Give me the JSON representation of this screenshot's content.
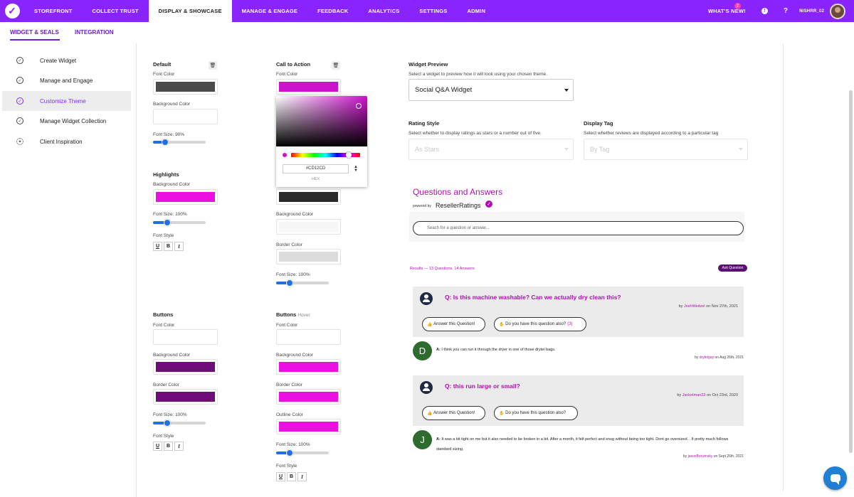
{
  "nav": {
    "items": [
      "STOREFRONT",
      "COLLECT TRUST",
      "DISPLAY & SHOWCASE",
      "MANAGE & ENGAGE",
      "FEEDBACK",
      "ANALYTICS",
      "SETTINGS",
      "ADMIN"
    ],
    "whats_new": "WHAT'S NEW!",
    "whats_new_badge": "2",
    "info_icon": "!",
    "help": "?",
    "username": "NISHRR_02"
  },
  "subtabs": [
    "WIDGET & SEALS",
    "INTEGRATION"
  ],
  "sidebar": {
    "items": [
      "Create Widget",
      "Manage and Engage",
      "Customize Theme",
      "Manage Widget Collection",
      "Client Inspiration"
    ]
  },
  "colors": {
    "brand": "#8a24ff",
    "default_font": "#4b4b4b",
    "cta_font": "#cd12cd",
    "highlight_bg": "#e910e0",
    "buttons_bg": "#6f0d78",
    "buttons_border": "#6f0d78",
    "hover_bg": "#e910e0",
    "hover_border": "#e910e0",
    "hover_outline": "#e910e0",
    "cta_dark": "#2a2a2a",
    "cta_bg": "#f7f7f7",
    "cta_border": "#dcdcdc"
  },
  "theme": {
    "default": {
      "title": "Default",
      "font_color": "Font Color",
      "bg_color": "Background Color",
      "font_size": "Font Size: 90%"
    },
    "highlights": {
      "title": "Highlights",
      "bg_color": "Background Color",
      "font_size": "Font Size: 100%",
      "font_style": "Font Style"
    },
    "buttons": {
      "title": "Buttons",
      "font_color": "Font Color",
      "bg_color": "Background Color",
      "border_color": "Border Color",
      "font_size": "Font Size: 100%",
      "font_style": "Font Style"
    },
    "cta": {
      "title": "Call to Action",
      "font_color": "Font Color",
      "bg_color": "Background Color",
      "border_color": "Border Color",
      "font_size": "Font Size: 100%"
    },
    "buttons_hover": {
      "title": "Buttons",
      "sub": "Hover",
      "font_color": "Font Color",
      "bg_color": "Background Color",
      "border_color": "Border Color",
      "outline_color": "Outline Color",
      "font_size": "Font Size: 100%",
      "font_style": "Font Style"
    },
    "style_buttons": [
      "U",
      "B",
      "I"
    ],
    "sliders": {
      "default": 0.25,
      "highlights": 0.3,
      "buttons": 0.3,
      "cta": 0.25,
      "hover": 0.25
    }
  },
  "picker": {
    "hex": "#CD12CD",
    "hex_label": "HEX"
  },
  "preview": {
    "title": "Widget Preview",
    "desc": "Select a widget to preview how it will look using your chosen theme.",
    "widget": "Social Q&A Widget",
    "rating_title": "Rating Style",
    "rating_desc": "Select whether to display ratings as stars or a number out of five.",
    "rating_value": "As Stars",
    "tag_title": "Display Tag",
    "tag_desc": "Select whether reviews are displayed according to a particular tag",
    "tag_value": "By Tag"
  },
  "qa": {
    "title": "Questions and Answers",
    "powered_by": "powered by",
    "brand": "ResellerRatings",
    "search_placeholder": "Seach for a question or answer...",
    "results": "Results  —  13 Questions, 14 Answers",
    "ask_button": "Ask Question",
    "answer_button": "Answer this Question!",
    "have_button": "Do you have this question also?",
    "questions": [
      {
        "q": "Q: Is this machine washable? Can we actually dry clean this?",
        "by": "by",
        "user": "JoshWeitzel",
        "date": "on Nov 27th, 2021",
        "count": "(3)",
        "answer_initial": "D",
        "answer_prefix": "A:",
        "answer": "I think you can run it through the dryer in one of those drytel bags.",
        "a_by": "by",
        "a_user": "drytelguy",
        "a_date": "on Aug 26th, 2021"
      },
      {
        "q": "Q: this run large or small?",
        "by": "by",
        "user": "Jacketman23",
        "date": "on Oct 23rd, 2020",
        "count": "",
        "answer_initial": "J",
        "answer_prefix": "A:",
        "answer": "It was a bit tight on me but it also needed to be broken in a bit. After a month, it felt perfect and snug without being too tight. Dont go oversized. . It pretty much follows standard sizing.",
        "a_by": "by",
        "a_user": "jasonBorizinsky",
        "a_date": "on Sept 26th, 2021"
      }
    ]
  }
}
